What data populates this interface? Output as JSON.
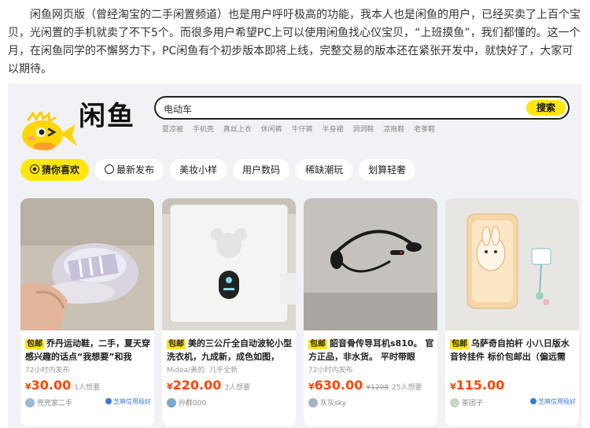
{
  "article": {
    "paragraph": "闲鱼网页版（曾经淘宝的二手闲置频道）也是用户呼吁极高的功能，我本人也是闲鱼的用户，已经买卖了上百个宝贝，光闲置的手机就卖了不下5个。而很多用户希望PC上可以使用闲鱼找心仪宝贝，“上班摸鱼”，我们都懂的。这一个月，在闲鱼同学的不懈努力下，PC闲鱼有个初步版本即将上线，完整交易的版本还在紧张开发中，就快好了，大家可以期待。"
  },
  "site": {
    "logo": "闲鱼"
  },
  "search": {
    "value": "电动车",
    "button": "搜索"
  },
  "hot_searches": [
    "夏凉被",
    "手机壳",
    "真丝上衣",
    "休闲裤",
    "牛仔裤",
    "半身裙",
    "洞洞鞋",
    "凉拖鞋",
    "老爹鞋"
  ],
  "tabs": [
    {
      "label": "猜你喜欢",
      "icon": "heart-circle-icon",
      "active": true
    },
    {
      "label": "最新发布",
      "icon": "clock-icon",
      "active": false
    },
    {
      "label": "美妆小样",
      "active": false
    },
    {
      "label": "用户数码",
      "active": false
    },
    {
      "label": "稀缺潮玩",
      "active": false
    },
    {
      "label": "划算轻奢",
      "active": false
    }
  ],
  "products": [
    {
      "badge": "包邮",
      "title": "乔丹运动鞋，二手，夏天穿 感兴趣的话点“我想要”和我",
      "meta": [
        "72小时内发布"
      ],
      "currency": "¥",
      "price": "30.00",
      "original_price": "",
      "wants": "1人想要",
      "seller": "兜兜家二手",
      "credit": "芝麻信用极好"
    },
    {
      "badge": "包邮",
      "title": "美的三公斤全自动波轮小型洗衣机，九成新，成色如图，",
      "meta": [
        "Midea/美的",
        "几乎全新"
      ],
      "currency": "¥",
      "price": "220.00",
      "original_price": "",
      "wants": "3人想要",
      "seller": "孙群000",
      "credit": ""
    },
    {
      "badge": "包邮",
      "title": "韶音骨传导耳机s810。 官方正品，非水货。 平时带眼",
      "meta": [
        "72小时内发布"
      ],
      "currency": "¥",
      "price": "630.00",
      "original_price": "¥1298",
      "wants": "25人想要",
      "seller": "灰灰sky",
      "credit": ""
    },
    {
      "badge": "包邮",
      "title": "乌萨奇自拍杆 小八日版水音铃挂件 标价包邮出（偏远需",
      "meta": [],
      "currency": "¥",
      "price": "115.00",
      "original_price": "",
      "wants": "",
      "seller": "茶团子",
      "credit": "芝麻信用极好"
    }
  ],
  "colors": {
    "brand_yellow": "#ffe60f",
    "price_red": "#ff4400",
    "page_bg": "#f1f2f5"
  }
}
